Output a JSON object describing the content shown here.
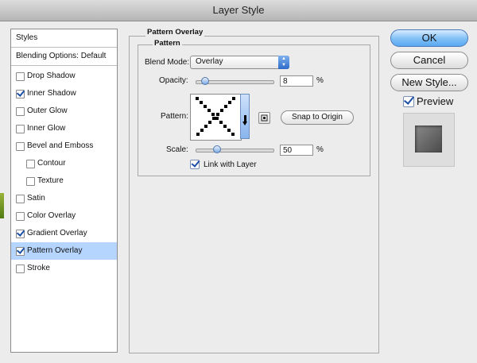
{
  "window": {
    "title": "Layer Style"
  },
  "styles": {
    "header": "Styles",
    "blending": "Blending Options: Default",
    "items": [
      {
        "label": "Drop Shadow",
        "checked": false,
        "sub": false,
        "selected": false
      },
      {
        "label": "Inner Shadow",
        "checked": true,
        "sub": false,
        "selected": false
      },
      {
        "label": "Outer Glow",
        "checked": false,
        "sub": false,
        "selected": false
      },
      {
        "label": "Inner Glow",
        "checked": false,
        "sub": false,
        "selected": false
      },
      {
        "label": "Bevel and Emboss",
        "checked": false,
        "sub": false,
        "selected": false
      },
      {
        "label": "Contour",
        "checked": false,
        "sub": true,
        "selected": false
      },
      {
        "label": "Texture",
        "checked": false,
        "sub": true,
        "selected": false
      },
      {
        "label": "Satin",
        "checked": false,
        "sub": false,
        "selected": false
      },
      {
        "label": "Color Overlay",
        "checked": false,
        "sub": false,
        "selected": false
      },
      {
        "label": "Gradient Overlay",
        "checked": true,
        "sub": false,
        "selected": false
      },
      {
        "label": "Pattern Overlay",
        "checked": true,
        "sub": false,
        "selected": true
      },
      {
        "label": "Stroke",
        "checked": false,
        "sub": false,
        "selected": false
      }
    ]
  },
  "panel": {
    "title": "Pattern Overlay",
    "group_title": "Pattern",
    "blend_mode_label": "Blend Mode:",
    "blend_mode_value": "Overlay",
    "opacity_label": "Opacity:",
    "opacity_value": "8",
    "opacity_fraction": 0.08,
    "percent": "%",
    "pattern_label": "Pattern:",
    "snap_label": "Snap to Origin",
    "scale_label": "Scale:",
    "scale_value": "50",
    "scale_fraction": 0.25,
    "link_label": "Link with Layer",
    "link_checked": true
  },
  "buttons": {
    "ok": "OK",
    "cancel": "Cancel",
    "new_style": "New Style..."
  },
  "preview": {
    "label": "Preview",
    "checked": true
  },
  "colors": {
    "selection": "#b5d5ff",
    "ok_button": "#6fb4f4",
    "check": "#1b4fa7"
  }
}
